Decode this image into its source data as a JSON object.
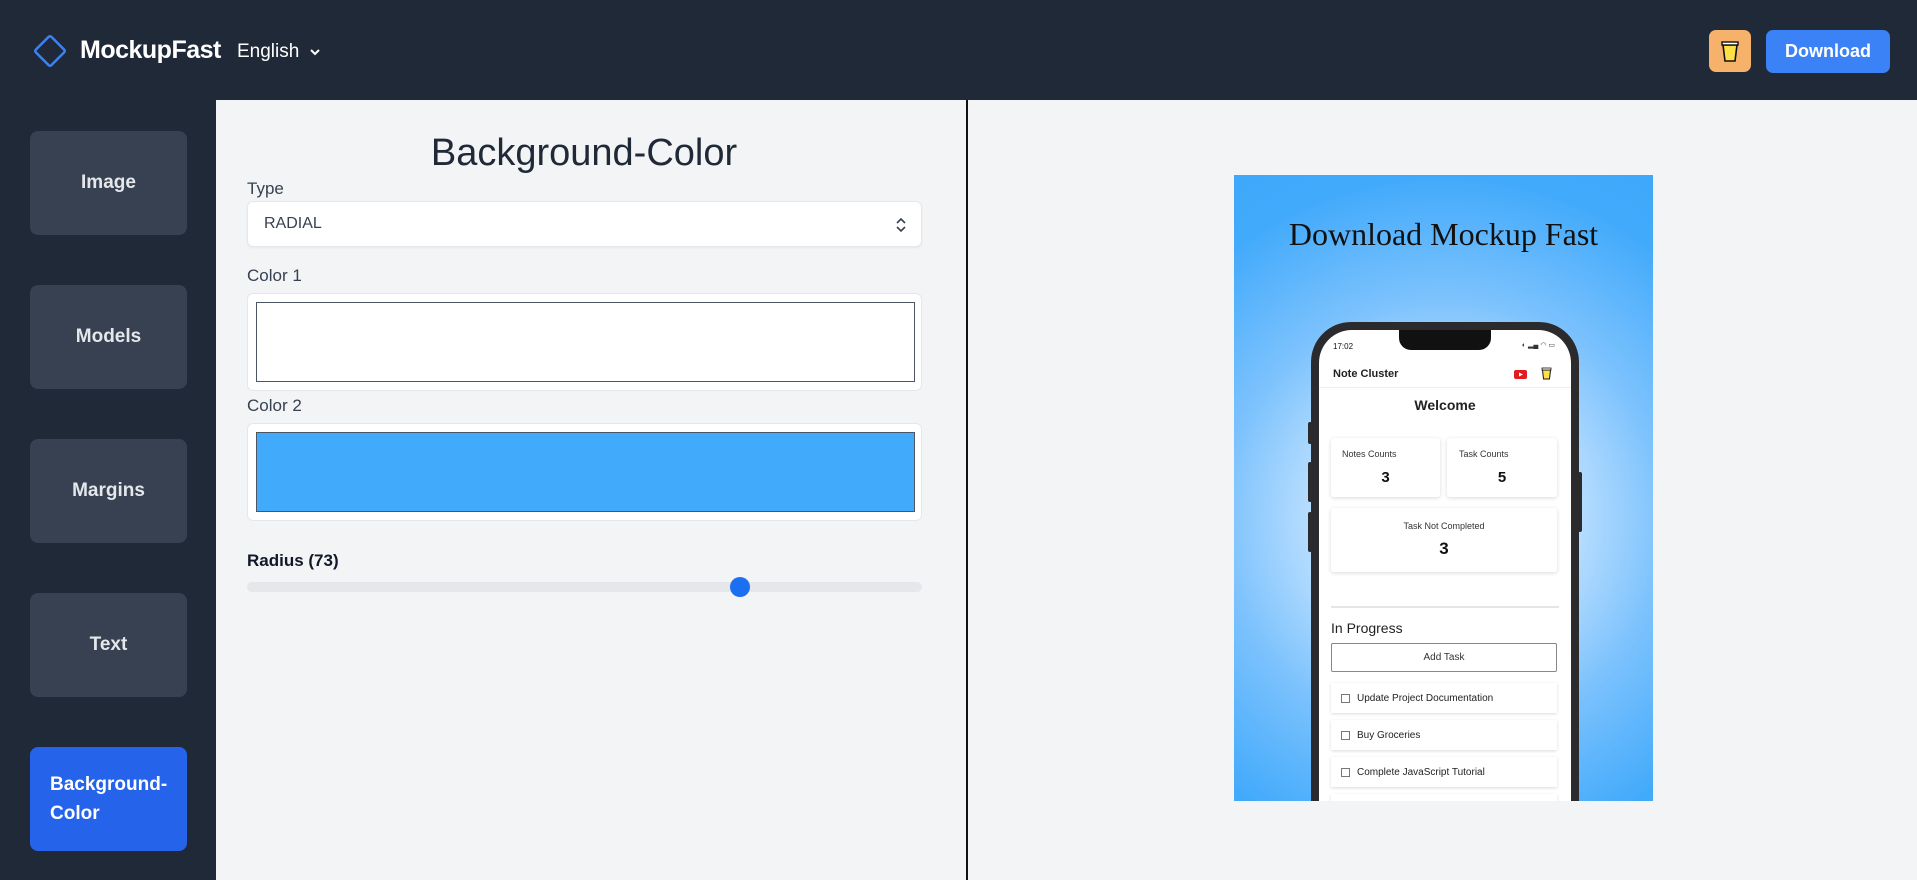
{
  "header": {
    "brand": "MockupFast",
    "language": "English",
    "download_label": "Download"
  },
  "sidebar": {
    "items": [
      {
        "label": "Image",
        "active": false
      },
      {
        "label": "Models",
        "active": false
      },
      {
        "label": "Margins",
        "active": false
      },
      {
        "label": "Text",
        "active": false
      },
      {
        "label": "Background-Color",
        "active": true
      }
    ]
  },
  "panel": {
    "title": "Background-Color",
    "type_label": "Type",
    "type_value": "RADIAL",
    "color1_label": "Color 1",
    "color1_value": "#ffffff",
    "color2_label": "Color 2",
    "color2_value": "#42aafb",
    "radius_label": "Radius (73)",
    "radius_value": 73
  },
  "preview": {
    "title": "Download Mockup Fast",
    "phone": {
      "time": "17:02",
      "app_title": "Note Cluster",
      "welcome": "Welcome",
      "notes_label": "Notes Counts",
      "notes_value": "3",
      "tasks_label": "Task Counts",
      "tasks_value": "5",
      "not_completed_label": "Task Not Completed",
      "not_completed_value": "3",
      "section": "In Progress",
      "add_task": "Add Task",
      "tasks": [
        "Update Project Documentation",
        "Buy Groceries",
        "Complete JavaScript Tutorial"
      ]
    }
  },
  "colors": {
    "accent": "#3b82f6",
    "active_nav": "#2563eb",
    "header_bg": "#1f2937"
  }
}
